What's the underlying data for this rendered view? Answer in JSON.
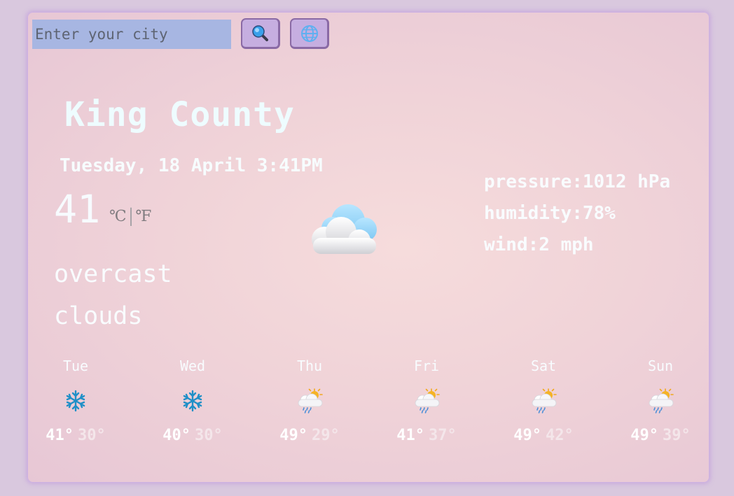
{
  "search": {
    "placeholder": "Enter your city"
  },
  "buttons": {
    "search_icon": "magnifier-icon",
    "location_icon": "globe-icon"
  },
  "current": {
    "city": "King County",
    "datetime": "Tuesday, 18 April 3:41PM",
    "temperature": "41",
    "unit_celsius": "℃",
    "unit_separator": "|",
    "unit_fahrenheit": "℉",
    "description_line1": "overcast",
    "description_line2": "clouds",
    "icon": "cloud-icon"
  },
  "stats": {
    "pressure": "pressure:1012 hPa",
    "humidity": "humidity:78%",
    "wind": "wind:2 mph"
  },
  "forecast": [
    {
      "day": "Tue",
      "hi": "41°",
      "lo": "30°",
      "icon": "snow-icon"
    },
    {
      "day": "Wed",
      "hi": "40°",
      "lo": "30°",
      "icon": "snow-icon"
    },
    {
      "day": "Thu",
      "hi": "49°",
      "lo": "29°",
      "icon": "sun-rain-icon"
    },
    {
      "day": "Fri",
      "hi": "41°",
      "lo": "37°",
      "icon": "sun-rain-icon"
    },
    {
      "day": "Sat",
      "hi": "49°",
      "lo": "42°",
      "icon": "sun-rain-icon"
    },
    {
      "day": "Sun",
      "hi": "49°",
      "lo": "39°",
      "icon": "sun-rain-icon"
    }
  ],
  "colors": {
    "card_bg": "#f0d3d8",
    "input_bg": "#a7b6e2",
    "button_bg": "#c6aee0",
    "text_light": "#eefcff"
  }
}
